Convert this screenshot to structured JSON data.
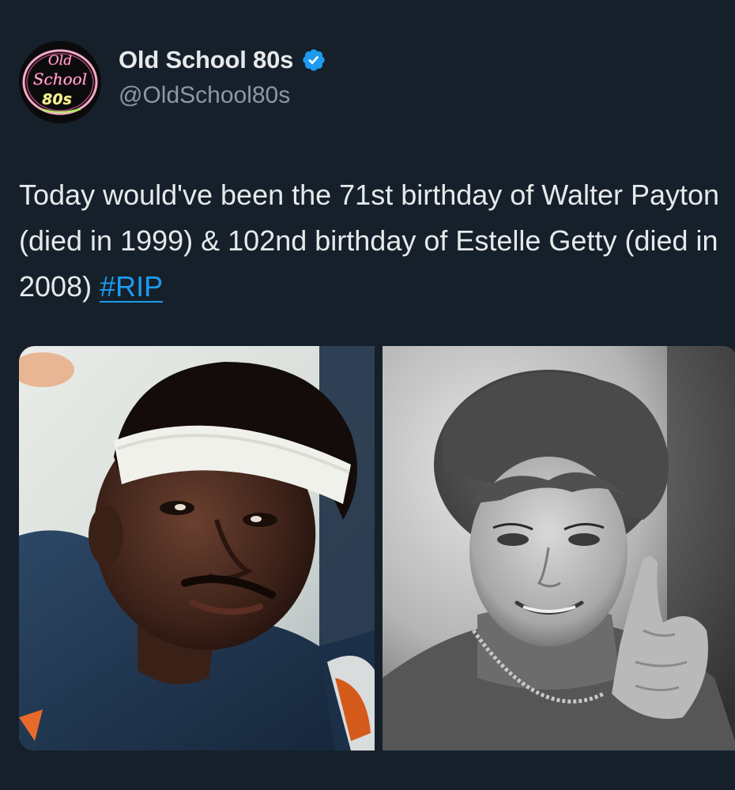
{
  "author": {
    "display_name": "Old School 80s",
    "handle": "@OldSchool80s",
    "verified": true,
    "avatar_icon": "neon-old-school-80s-logo",
    "avatar_logo_text": [
      "Old",
      "School",
      "80s"
    ]
  },
  "tweet": {
    "text_before_hashtag": "Today would've been the 71st birthday of Walter Payton (died in 1999) & 102nd birthday of Estelle Getty (died in 2008) ",
    "hashtag": "#RIP"
  },
  "media": [
    {
      "name": "photo-walter-payton",
      "style": "color"
    },
    {
      "name": "photo-estelle-getty",
      "style": "black-and-white"
    }
  ],
  "colors": {
    "background": "#15202b",
    "text": "#e7e9ea",
    "secondary_text": "#8b98a5",
    "link": "#1d9bf0",
    "verified_badge": "#1d9bf0"
  }
}
